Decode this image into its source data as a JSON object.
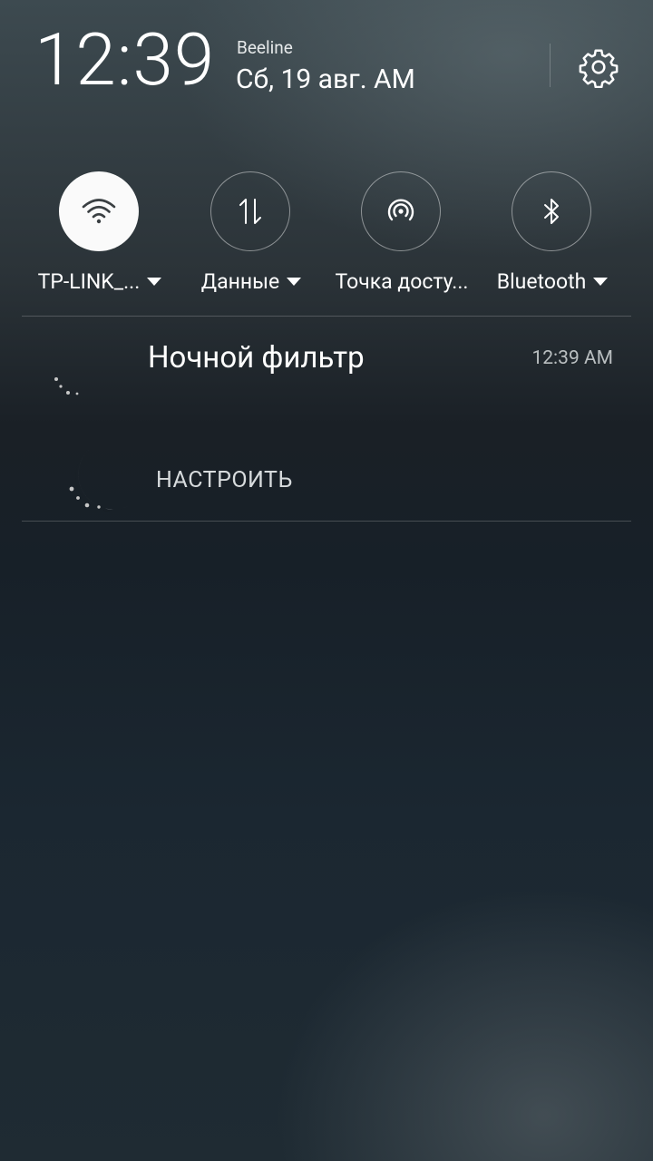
{
  "status": {
    "time": "12:39",
    "carrier": "Beeline",
    "date": "Сб, 19 авг. AM"
  },
  "quick_settings": [
    {
      "label": "TP-LINK_...",
      "icon": "wifi-icon",
      "active": true,
      "has_dropdown": true
    },
    {
      "label": "Данные",
      "icon": "mobile-data-icon",
      "active": false,
      "has_dropdown": true
    },
    {
      "label": "Точка досту...",
      "icon": "hotspot-icon",
      "active": false,
      "has_dropdown": false
    },
    {
      "label": "Bluetooth",
      "icon": "bluetooth-icon",
      "active": false,
      "has_dropdown": true
    }
  ],
  "notification": {
    "app_icon": "moon-icon",
    "title": "Ночной фильтр",
    "time": "12:39 AM",
    "action_label": "НАСТРОИТЬ"
  },
  "colors": {
    "accent_active_tile": "#fafafa",
    "text_primary": "#ffffff",
    "text_secondary": "#b9bec0"
  }
}
